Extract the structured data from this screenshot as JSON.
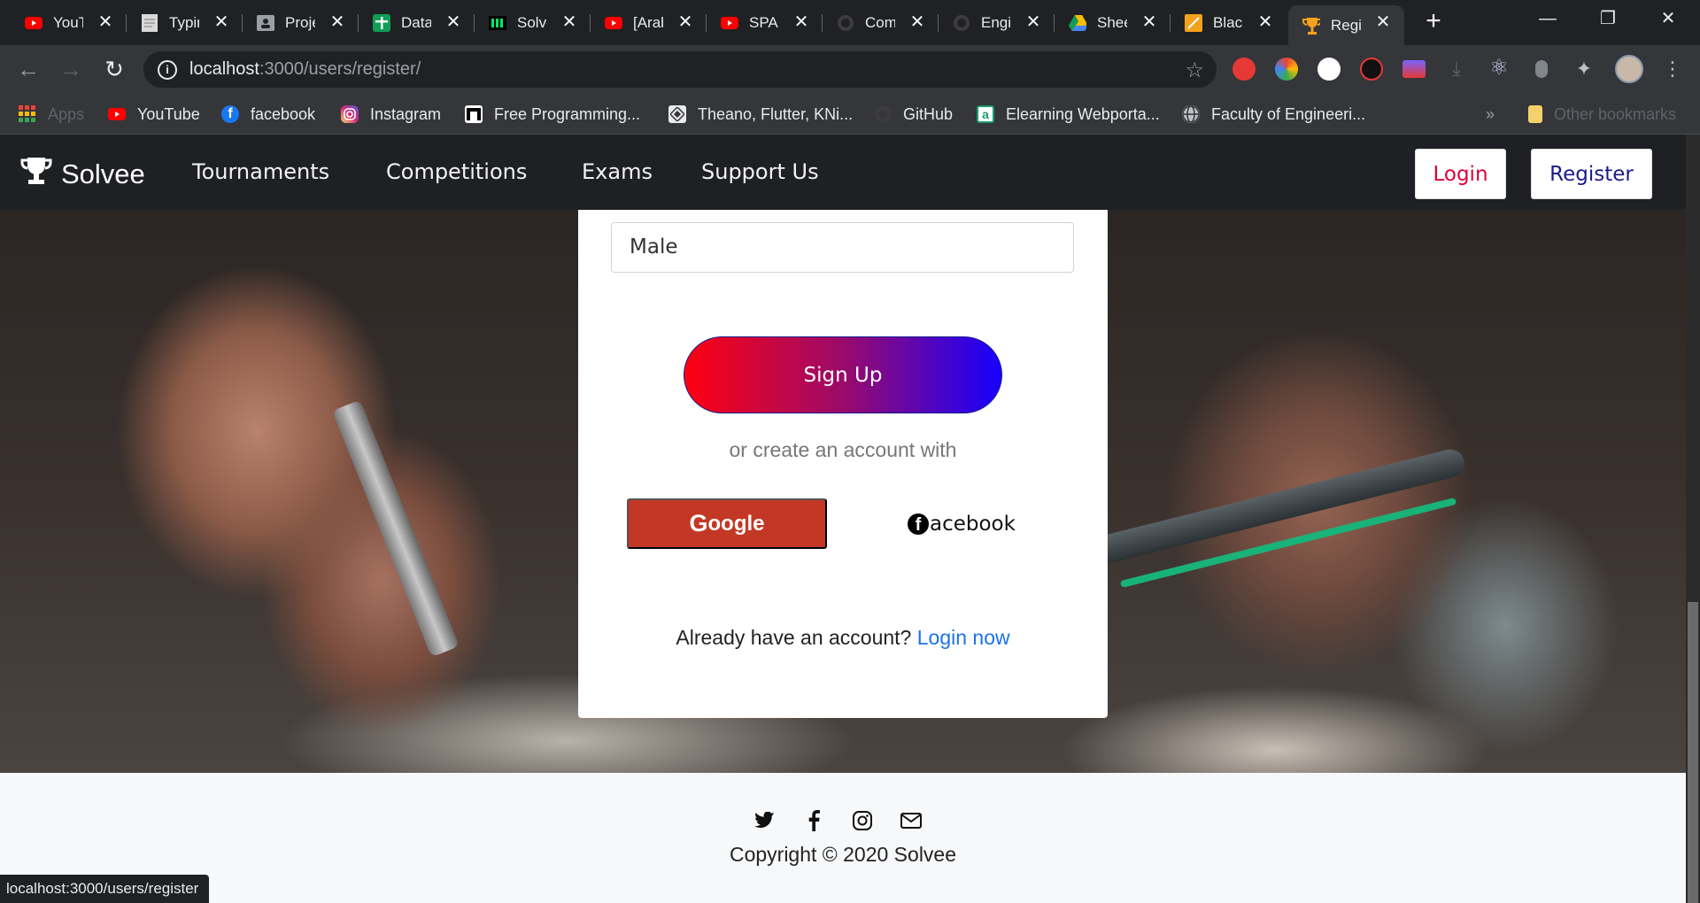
{
  "browser": {
    "tabs": [
      {
        "title": "YouTube",
        "icon": "youtube-icon",
        "color": "#ff0000"
      },
      {
        "title": "Typing",
        "icon": "document-icon",
        "color": "#bdbdbd"
      },
      {
        "title": "Projects",
        "icon": "contact-icon",
        "color": "#9aa0a6"
      },
      {
        "title": "Data",
        "icon": "sheets-plus-icon",
        "color": "#0f9d58"
      },
      {
        "title": "Solve",
        "icon": "hackerrank-icon",
        "color": "#00ea64"
      },
      {
        "title": "[Arabic",
        "icon": "youtube-icon",
        "color": "#ff0000"
      },
      {
        "title": "SPA",
        "icon": "youtube-icon",
        "color": "#ff0000"
      },
      {
        "title": "Com",
        "icon": "github-icon",
        "color": "#3c3c3c"
      },
      {
        "title": "Engi",
        "icon": "github-icon",
        "color": "#3c3c3c"
      },
      {
        "title": "Sheet",
        "icon": "drive-icon",
        "color": "#fbbc04"
      },
      {
        "title": "Black",
        "icon": "notes-icon",
        "color": "#f4a21b"
      },
      {
        "title": "Regi",
        "icon": "trophy-icon",
        "color": "#f4a21b",
        "active": true
      }
    ],
    "address": {
      "host": "localhost",
      "path": ":3000/users/register/"
    },
    "bookmarks": [
      {
        "label": "Apps",
        "icon": "apps-grid-icon"
      },
      {
        "label": "YouTube",
        "icon": "youtube-icon"
      },
      {
        "label": "facebook",
        "icon": "facebook-icon"
      },
      {
        "label": "Instagram",
        "icon": "instagram-icon"
      },
      {
        "label": "Free Programming...",
        "icon": "ftb-icon"
      },
      {
        "label": "Theano, Flutter, KNi...",
        "icon": "pattern-icon"
      },
      {
        "label": "GitHub",
        "icon": "github-icon"
      },
      {
        "label": "Elearning Webporta...",
        "icon": "elearning-icon"
      },
      {
        "label": "Faculty of Engineeri...",
        "icon": "globe-icon"
      }
    ],
    "bookmarks_more": "»",
    "other_bookmarks": "Other bookmarks",
    "status_url": "localhost:3000/users/register"
  },
  "site": {
    "brand": "Solvee",
    "nav": [
      "Tournaments",
      "Competitions",
      "Exams",
      "Support Us"
    ],
    "login_label": "Login",
    "register_label": "Register"
  },
  "form": {
    "gender_value": "Male",
    "signup_label": "Sign Up",
    "or_text": "or create an account with",
    "google_label": "oogle",
    "google_g": "G",
    "facebook_label": "acebook",
    "already_text": "Already have an account?",
    "login_now": "Login now"
  },
  "footer": {
    "socials": [
      "twitter-icon",
      "facebook-f-icon",
      "instagram-icon",
      "mail-icon"
    ],
    "copyright": "Copyright © 2020 Solvee"
  }
}
